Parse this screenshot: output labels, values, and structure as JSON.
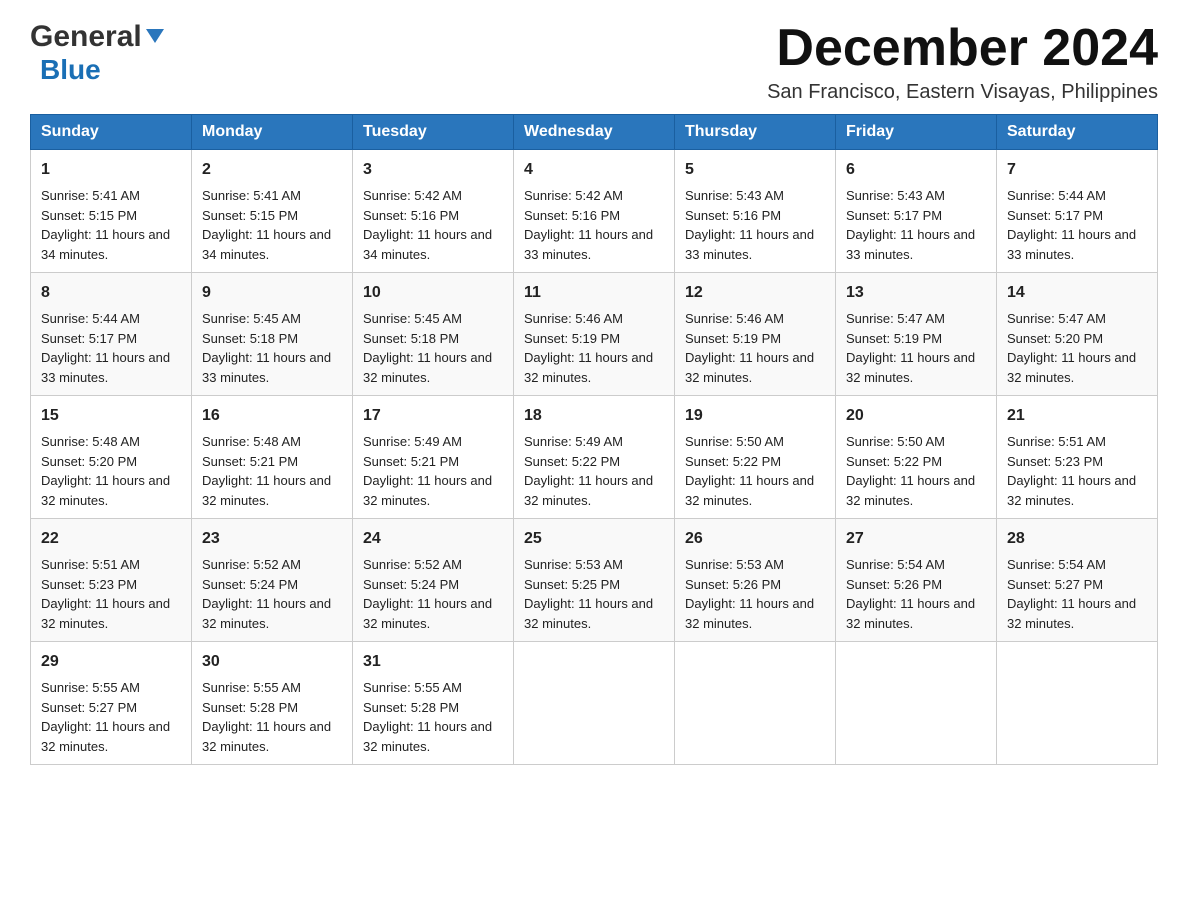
{
  "header": {
    "logo_general": "General",
    "logo_blue": "Blue",
    "month_year": "December 2024",
    "location": "San Francisco, Eastern Visayas, Philippines"
  },
  "calendar": {
    "days_of_week": [
      "Sunday",
      "Monday",
      "Tuesday",
      "Wednesday",
      "Thursday",
      "Friday",
      "Saturday"
    ],
    "weeks": [
      [
        {
          "date": "1",
          "sunrise": "5:41 AM",
          "sunset": "5:15 PM",
          "daylight": "11 hours and 34 minutes."
        },
        {
          "date": "2",
          "sunrise": "5:41 AM",
          "sunset": "5:15 PM",
          "daylight": "11 hours and 34 minutes."
        },
        {
          "date": "3",
          "sunrise": "5:42 AM",
          "sunset": "5:16 PM",
          "daylight": "11 hours and 34 minutes."
        },
        {
          "date": "4",
          "sunrise": "5:42 AM",
          "sunset": "5:16 PM",
          "daylight": "11 hours and 33 minutes."
        },
        {
          "date": "5",
          "sunrise": "5:43 AM",
          "sunset": "5:16 PM",
          "daylight": "11 hours and 33 minutes."
        },
        {
          "date": "6",
          "sunrise": "5:43 AM",
          "sunset": "5:17 PM",
          "daylight": "11 hours and 33 minutes."
        },
        {
          "date": "7",
          "sunrise": "5:44 AM",
          "sunset": "5:17 PM",
          "daylight": "11 hours and 33 minutes."
        }
      ],
      [
        {
          "date": "8",
          "sunrise": "5:44 AM",
          "sunset": "5:17 PM",
          "daylight": "11 hours and 33 minutes."
        },
        {
          "date": "9",
          "sunrise": "5:45 AM",
          "sunset": "5:18 PM",
          "daylight": "11 hours and 33 minutes."
        },
        {
          "date": "10",
          "sunrise": "5:45 AM",
          "sunset": "5:18 PM",
          "daylight": "11 hours and 32 minutes."
        },
        {
          "date": "11",
          "sunrise": "5:46 AM",
          "sunset": "5:19 PM",
          "daylight": "11 hours and 32 minutes."
        },
        {
          "date": "12",
          "sunrise": "5:46 AM",
          "sunset": "5:19 PM",
          "daylight": "11 hours and 32 minutes."
        },
        {
          "date": "13",
          "sunrise": "5:47 AM",
          "sunset": "5:19 PM",
          "daylight": "11 hours and 32 minutes."
        },
        {
          "date": "14",
          "sunrise": "5:47 AM",
          "sunset": "5:20 PM",
          "daylight": "11 hours and 32 minutes."
        }
      ],
      [
        {
          "date": "15",
          "sunrise": "5:48 AM",
          "sunset": "5:20 PM",
          "daylight": "11 hours and 32 minutes."
        },
        {
          "date": "16",
          "sunrise": "5:48 AM",
          "sunset": "5:21 PM",
          "daylight": "11 hours and 32 minutes."
        },
        {
          "date": "17",
          "sunrise": "5:49 AM",
          "sunset": "5:21 PM",
          "daylight": "11 hours and 32 minutes."
        },
        {
          "date": "18",
          "sunrise": "5:49 AM",
          "sunset": "5:22 PM",
          "daylight": "11 hours and 32 minutes."
        },
        {
          "date": "19",
          "sunrise": "5:50 AM",
          "sunset": "5:22 PM",
          "daylight": "11 hours and 32 minutes."
        },
        {
          "date": "20",
          "sunrise": "5:50 AM",
          "sunset": "5:22 PM",
          "daylight": "11 hours and 32 minutes."
        },
        {
          "date": "21",
          "sunrise": "5:51 AM",
          "sunset": "5:23 PM",
          "daylight": "11 hours and 32 minutes."
        }
      ],
      [
        {
          "date": "22",
          "sunrise": "5:51 AM",
          "sunset": "5:23 PM",
          "daylight": "11 hours and 32 minutes."
        },
        {
          "date": "23",
          "sunrise": "5:52 AM",
          "sunset": "5:24 PM",
          "daylight": "11 hours and 32 minutes."
        },
        {
          "date": "24",
          "sunrise": "5:52 AM",
          "sunset": "5:24 PM",
          "daylight": "11 hours and 32 minutes."
        },
        {
          "date": "25",
          "sunrise": "5:53 AM",
          "sunset": "5:25 PM",
          "daylight": "11 hours and 32 minutes."
        },
        {
          "date": "26",
          "sunrise": "5:53 AM",
          "sunset": "5:26 PM",
          "daylight": "11 hours and 32 minutes."
        },
        {
          "date": "27",
          "sunrise": "5:54 AM",
          "sunset": "5:26 PM",
          "daylight": "11 hours and 32 minutes."
        },
        {
          "date": "28",
          "sunrise": "5:54 AM",
          "sunset": "5:27 PM",
          "daylight": "11 hours and 32 minutes."
        }
      ],
      [
        {
          "date": "29",
          "sunrise": "5:55 AM",
          "sunset": "5:27 PM",
          "daylight": "11 hours and 32 minutes."
        },
        {
          "date": "30",
          "sunrise": "5:55 AM",
          "sunset": "5:28 PM",
          "daylight": "11 hours and 32 minutes."
        },
        {
          "date": "31",
          "sunrise": "5:55 AM",
          "sunset": "5:28 PM",
          "daylight": "11 hours and 32 minutes."
        },
        null,
        null,
        null,
        null
      ]
    ]
  },
  "labels": {
    "sunrise_prefix": "Sunrise: ",
    "sunset_prefix": "Sunset: ",
    "daylight_prefix": "Daylight: "
  }
}
